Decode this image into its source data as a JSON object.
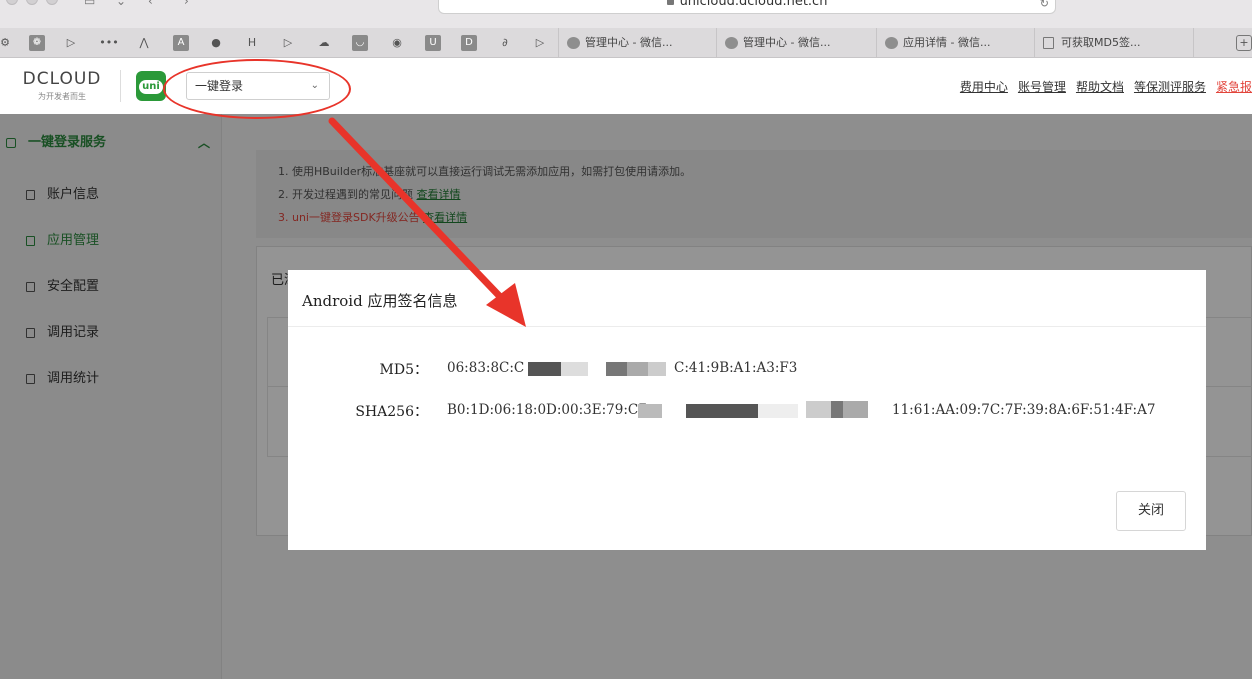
{
  "browser": {
    "url": "unicloud.dcloud.net.cn",
    "bookmark_glyphs": [
      "❁",
      "▷",
      "•••",
      "⋀",
      "A",
      "",
      "H",
      "▷",
      "☁",
      "◡",
      "◉",
      "U",
      "D",
      "∂",
      "▷"
    ],
    "tabs": [
      "管理中心 - 微信...",
      "管理中心 - 微信...",
      "应用详情 - 微信...",
      "可获取MD5签..."
    ]
  },
  "header": {
    "logo_text": "DCLOUD",
    "logo_tagline": "为开发者而生",
    "uni_badge": "uni",
    "service_select": "一键登录",
    "links": [
      "费用中心",
      "账号管理",
      "帮助文档",
      "等保测评服务",
      "紧急报"
    ]
  },
  "sidebar": {
    "group_title": "一键登录服务",
    "items": [
      {
        "label": "账户信息",
        "active": false
      },
      {
        "label": "应用管理",
        "active": true
      },
      {
        "label": "安全配置",
        "active": false
      },
      {
        "label": "调用记录",
        "active": false
      },
      {
        "label": "调用统计",
        "active": false
      }
    ]
  },
  "notice": {
    "line1": "1. 使用HBuilder标准基座就可以直接运行调试无需添加应用，如需打包使用请添加。",
    "line2_text": "2. 开发过程遇到的常见问题",
    "line2_link": "查看详情",
    "line3_text": "3. uni一键登录SDK升级公告",
    "line3_link": "查看详情"
  },
  "panel": {
    "title": "已添加的应用"
  },
  "modal": {
    "title": "Android 应用签名信息",
    "md5_label": "MD5：",
    "md5_prefix": "06:83:8C:C",
    "md5_suffix": "C:41:9B:A1:A3:F3",
    "sha256_label": "SHA256：",
    "sha256_prefix": "B0:1D:06:18:0D:00:3E:79:C7",
    "sha256_suffix": "11:61:AA:09:7C:7F:39:8A:6F:51:4F:A7",
    "close_label": "关闭"
  },
  "colors": {
    "accent_green": "#2b8a3e",
    "annotation_red": "#e8342a",
    "link_red": "#e2453c"
  }
}
